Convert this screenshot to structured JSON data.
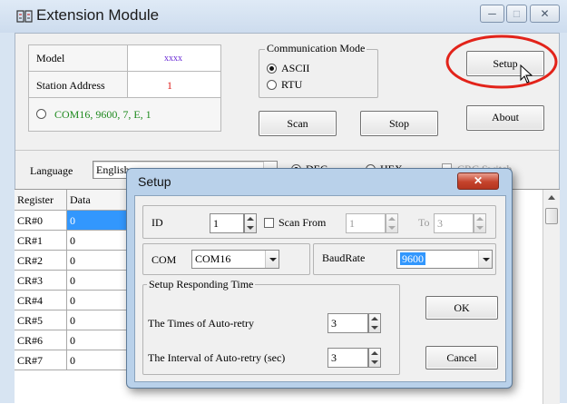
{
  "window": {
    "title": "Extension Module",
    "minimize_glyph": "─",
    "maximize_glyph": "□",
    "close_glyph": "✕"
  },
  "info": {
    "model_label": "Model",
    "model_value": "xxxx",
    "station_label": "Station Address",
    "station_value": "1",
    "conn_text": "COM16, 9600, 7, E, 1"
  },
  "comm_mode": {
    "title": "Communication Mode",
    "options": [
      "ASCII",
      "RTU"
    ],
    "selected": "ASCII"
  },
  "buttons": {
    "setup": "Setup",
    "about": "About",
    "scan": "Scan",
    "stop": "Stop"
  },
  "language": {
    "label": "Language",
    "value": "English"
  },
  "format": {
    "dec": "DEC",
    "hex": "HEX",
    "crc": "CRC Switch"
  },
  "table": {
    "headers": [
      "Register",
      "Data"
    ],
    "rows": [
      {
        "register": "CR#0",
        "data": "0"
      },
      {
        "register": "CR#1",
        "data": "0"
      },
      {
        "register": "CR#2",
        "data": "0"
      },
      {
        "register": "CR#3",
        "data": "0"
      },
      {
        "register": "CR#4",
        "data": "0"
      },
      {
        "register": "CR#5",
        "data": "0"
      },
      {
        "register": "CR#6",
        "data": "0"
      },
      {
        "register": "CR#7",
        "data": "0"
      }
    ]
  },
  "setup_dialog": {
    "title": "Setup",
    "close_glyph": "✕",
    "id_label": "ID",
    "id_value": "1",
    "scan_from_label": "Scan From",
    "scan_from_value": "1",
    "to_label": "To",
    "to_value": "3",
    "com_label": "COM",
    "com_value": "COM16",
    "baud_label": "BaudRate",
    "baud_value": "9600",
    "resp_group_title": "Setup Responding Time",
    "retry_label": "The Times of Auto-retry",
    "retry_value": "3",
    "interval_label": "The Interval of Auto-retry (sec)",
    "interval_value": "3",
    "ok": "OK",
    "cancel": "Cancel"
  },
  "colors": {
    "model_value": "#6b2bd6",
    "station_value": "#e0201e",
    "conn_text": "#1f8a1f",
    "selected_cell": "#3297fd",
    "highlight_ring": "#e2231a"
  }
}
